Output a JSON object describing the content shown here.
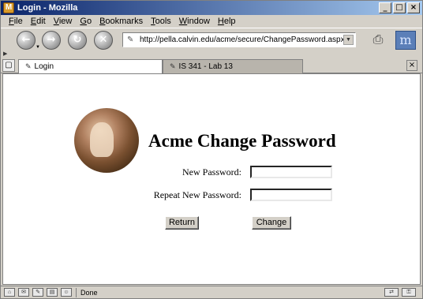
{
  "window": {
    "title": "Login - Mozilla",
    "controls": {
      "minimize": "_",
      "maximize": "□",
      "close": "×"
    }
  },
  "menu": [
    {
      "accel": "F",
      "rest": "ile"
    },
    {
      "accel": "E",
      "rest": "dit"
    },
    {
      "accel": "V",
      "rest": "iew"
    },
    {
      "accel": "G",
      "rest": "o"
    },
    {
      "accel": "B",
      "rest": "ookmarks"
    },
    {
      "accel": "T",
      "rest": "ools"
    },
    {
      "accel": "W",
      "rest": "indow"
    },
    {
      "accel": "H",
      "rest": "elp"
    }
  ],
  "toolbar": {
    "back_glyph": "←",
    "forward_glyph": "→",
    "reload_glyph": "↻",
    "stop_glyph": "✕",
    "url": "http://pella.calvin.edu/acme/secure/ChangePassword.aspx",
    "throbber_glyph": "m"
  },
  "tabs": [
    {
      "label": "Login",
      "active": true
    },
    {
      "label": "IS 341 - Lab 13",
      "active": false
    }
  ],
  "page": {
    "title": "Acme Change Password",
    "new_password_label": "New Password:",
    "repeat_password_label": "Repeat New Password:",
    "new_password_value": "",
    "repeat_password_value": "",
    "return_button": "Return",
    "change_button": "Change"
  },
  "status": {
    "text": "Done"
  },
  "icons": {
    "app": "mozilla-icon",
    "logo": "acme-logo-painting"
  }
}
